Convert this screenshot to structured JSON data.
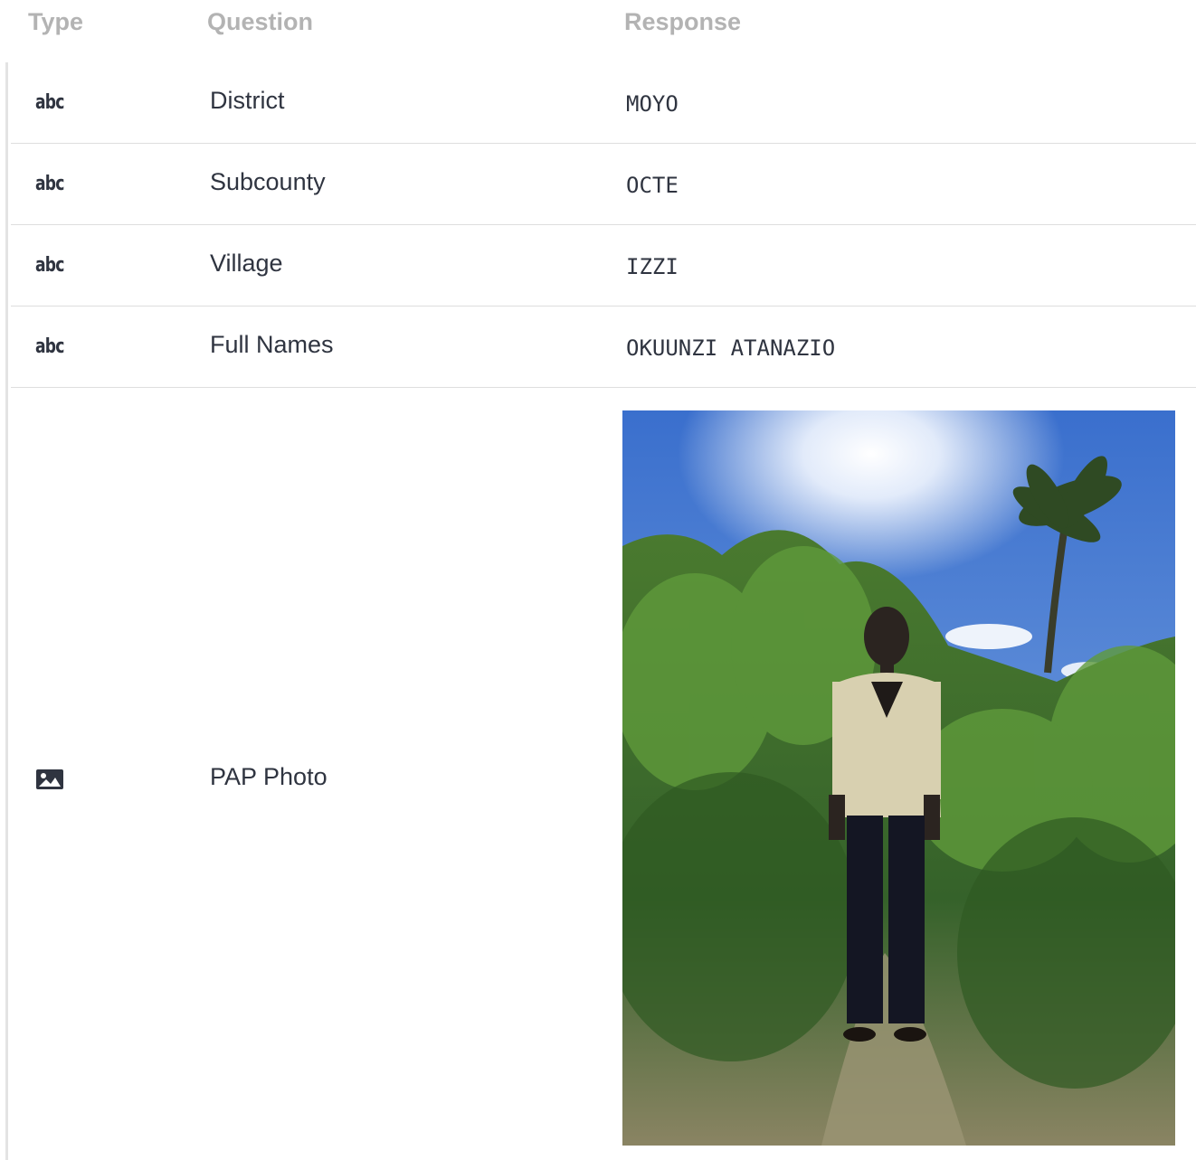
{
  "header": {
    "type_label": "Type",
    "question_label": "Question",
    "response_label": "Response"
  },
  "rows": [
    {
      "type_icon": "text-icon",
      "type_glyph": "abc",
      "question": "District",
      "response": "MOYO"
    },
    {
      "type_icon": "text-icon",
      "type_glyph": "abc",
      "question": "Subcounty",
      "response": "OCTE"
    },
    {
      "type_icon": "text-icon",
      "type_glyph": "abc",
      "question": "Village",
      "response": "IZZI"
    },
    {
      "type_icon": "text-icon",
      "type_glyph": "abc",
      "question": "Full Names",
      "response": "OKUUNZI ATANAZIO"
    },
    {
      "type_icon": "image-icon",
      "question": "PAP Photo",
      "response_kind": "photo"
    }
  ],
  "colors": {
    "header_text": "#b3b3b3",
    "body_text": "#2f3440",
    "row_divider": "#dedede"
  }
}
